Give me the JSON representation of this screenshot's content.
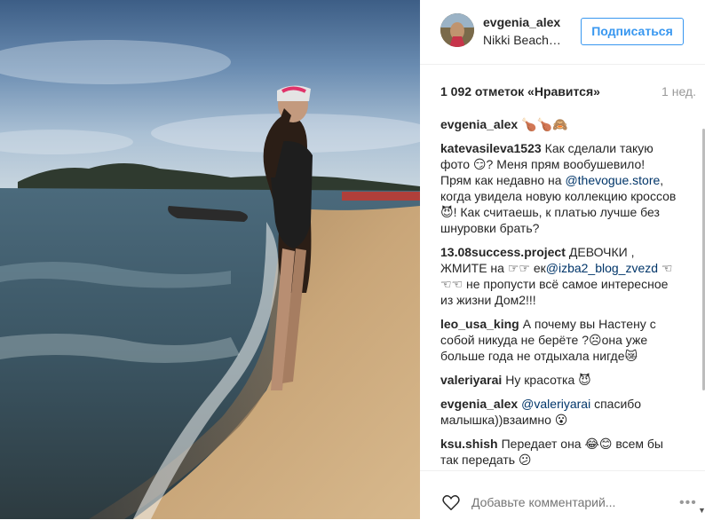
{
  "post": {
    "username": "evgenia_alex",
    "location": "Nikki Beach…",
    "follow_label": "Подписаться",
    "likes_text": "1 092 отметок «Нравится»",
    "time_ago": "1 нед."
  },
  "comments": [
    {
      "user": "evgenia_alex",
      "segments": [
        {
          "t": "🍗🍗🙈"
        }
      ]
    },
    {
      "user": "katevasileva1523",
      "segments": [
        {
          "t": "Как сделали такую фото 😏? Меня прям вообушевило! Прям как недавно на "
        },
        {
          "t": "@thevogue.store",
          "m": true
        },
        {
          "t": ", когда увидела новую коллекцию кроссов 😈! Как считаешь, к платью лучше без шнуровки брать?"
        }
      ]
    },
    {
      "user": "13.08success.project",
      "segments": [
        {
          "t": "ДЕВОЧКИ , ЖМИТЕ на ☞☞ ек"
        },
        {
          "t": "@izba2_blog_zvezd",
          "m": true
        },
        {
          "t": " ☜☜☜ не пропусти всё самое интересное из жизни Дом2!!!"
        }
      ]
    },
    {
      "user": "leo_usa_king",
      "segments": [
        {
          "t": "А почему вы Настену с собой никуда не берёте ?☹она уже больше года не отдыхала нигде😿"
        }
      ]
    },
    {
      "user": "valeriyarai",
      "segments": [
        {
          "t": "Ну красотка 😈"
        }
      ]
    },
    {
      "user": "evgenia_alex",
      "segments": [
        {
          "t": "@valeriyarai",
          "m": true
        },
        {
          "t": " спасибо малышка))взаимно 😮"
        }
      ]
    },
    {
      "user": "ksu.shish",
      "segments": [
        {
          "t": "Передает она 😂😊 всем бы так передать 😕"
        }
      ]
    }
  ],
  "footer": {
    "comment_placeholder": "Добавьте комментарий...",
    "more": "•••"
  },
  "colors": {
    "accent": "#3897f0",
    "mention": "#003569",
    "muted": "#999999"
  }
}
